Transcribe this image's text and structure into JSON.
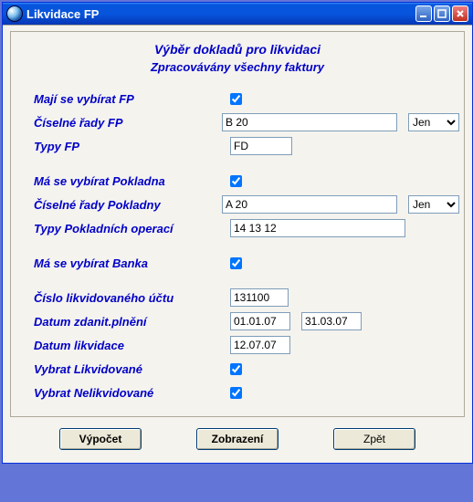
{
  "window": {
    "title": "Likvidace FP"
  },
  "header": {
    "title": "Výběr dokladů pro likvidaci",
    "subtitle": "Zpracovávány všechny faktury"
  },
  "labels": {
    "select_fp": "Mají se vybírat FP",
    "fp_series": "Číselné řady FP",
    "fp_types": "Typy FP",
    "select_cash": "Má se vybírat Pokladna",
    "cash_series": "Číselné řady Pokladny",
    "cash_op_types": "Typy Pokladních operací",
    "select_bank": "Má se vybírat Banka",
    "account_no": "Číslo likvidovaného účtu",
    "tax_date": "Datum zdanit.plnění",
    "liq_date": "Datum likvidace",
    "select_liquidated": "Vybrat Likvidované",
    "select_unliquidated": "Vybrat Nelikvidované"
  },
  "values": {
    "fp_series": "B 20",
    "fp_series_mode": "Jen",
    "fp_types": "FD",
    "cash_series": "A 20",
    "cash_series_mode": "Jen",
    "cash_op_types": "14 13 12",
    "account_no": "131100",
    "tax_date_from": "01.01.07",
    "tax_date_to": "31.03.07",
    "liq_date": "12.07.07"
  },
  "buttons": {
    "calc": "Výpočet",
    "show": "Zobrazení",
    "back": "Zpět"
  }
}
